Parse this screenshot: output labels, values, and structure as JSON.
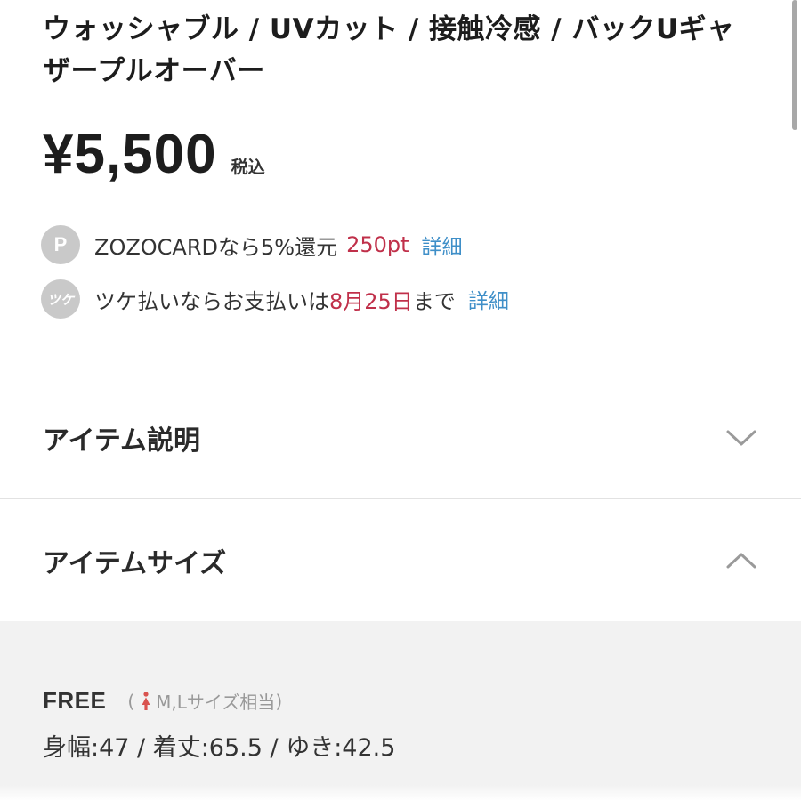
{
  "product": {
    "title": "ウォッシャブル / UVカット / 接触冷感 / バックUギャザープルオーバー",
    "price": "¥5,500",
    "tax_label": "税込"
  },
  "info": {
    "zozocard": {
      "icon": "P",
      "text": "ZOZOCARDなら5%還元",
      "points": "250pt",
      "link": "詳細"
    },
    "tsuke": {
      "icon": "ツケ",
      "text_before": "ツケ払いならお支払いは",
      "date": "8月25日",
      "text_after": "まで",
      "link": "詳細"
    }
  },
  "sections": {
    "description": {
      "title": "アイテム説明",
      "icon": "chevron-down-icon",
      "state": "collapsed"
    },
    "size": {
      "title": "アイテムサイズ",
      "icon": "chevron-up-icon",
      "state": "expanded"
    }
  },
  "size_detail": {
    "name": "FREE",
    "open_paren": "(",
    "note": "M,Lサイズ相当",
    "close_paren": ")",
    "gender_icon": "woman-icon",
    "values": "身幅:47 / 着丈:65.5 / ゆき:42.5"
  },
  "colors": {
    "accent_red": "#c0304a",
    "link_blue": "#3f8fc8",
    "icon_gray": "#c9c9c9",
    "woman_icon": "#d9534f"
  }
}
